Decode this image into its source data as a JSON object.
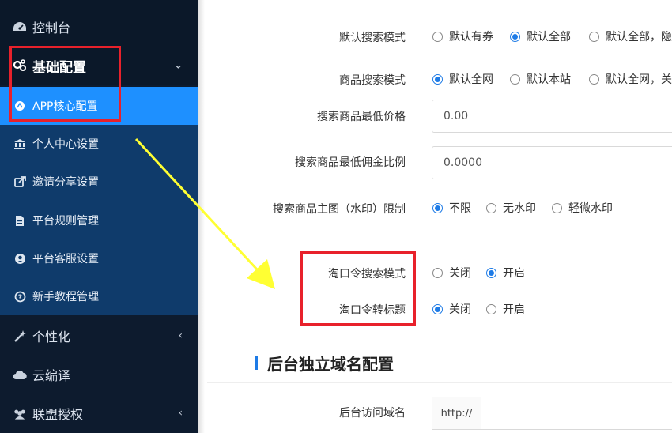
{
  "sidebar": {
    "dashboard": "控制台",
    "group": "基础配置",
    "items": [
      {
        "label": "APP核心配置",
        "icon": "app-circle-icon"
      },
      {
        "label": "个人中心设置",
        "icon": "bank-icon"
      },
      {
        "label": "邀请分享设置",
        "icon": "share-icon"
      },
      {
        "label": "平台规则管理",
        "icon": "document-icon"
      },
      {
        "label": "平台客服设置",
        "icon": "user-circle-icon"
      },
      {
        "label": "新手教程管理",
        "icon": "question-circle-icon"
      }
    ],
    "personalize": "个性化",
    "cloud_compile": "云编译",
    "alliance": "联盟授权"
  },
  "form": {
    "default_search_mode": {
      "label": "默认搜索模式",
      "options": [
        "默认有券",
        "默认全部",
        "默认全部，隐"
      ],
      "selected": 1
    },
    "product_search_mode": {
      "label": "商品搜索模式",
      "options": [
        "默认全网",
        "默认本站",
        "默认全网，关"
      ],
      "selected": 0
    },
    "min_price": {
      "label": "搜索商品最低价格",
      "value": "0.00"
    },
    "min_commission": {
      "label": "搜索商品最低佣金比例",
      "value": "0.0000"
    },
    "watermark": {
      "label": "搜索商品主图（水印）限制",
      "options": [
        "不限",
        "无水印",
        "轻微水印"
      ],
      "selected": 0
    },
    "taokou_search": {
      "label": "淘口令搜索模式",
      "options": [
        "关闭",
        "开启"
      ],
      "selected": 1
    },
    "taokou_title": {
      "label": "淘口令转标题",
      "options": [
        "关闭",
        "开启"
      ],
      "selected": 0
    }
  },
  "section": {
    "title": "后台独立域名配置",
    "domain_label": "后台访问域名",
    "prefix": "http://",
    "value": ""
  },
  "colors": {
    "accent": "#1e90ff",
    "annotation_red": "#e8212b",
    "annotation_yellow": "#ffff33"
  }
}
